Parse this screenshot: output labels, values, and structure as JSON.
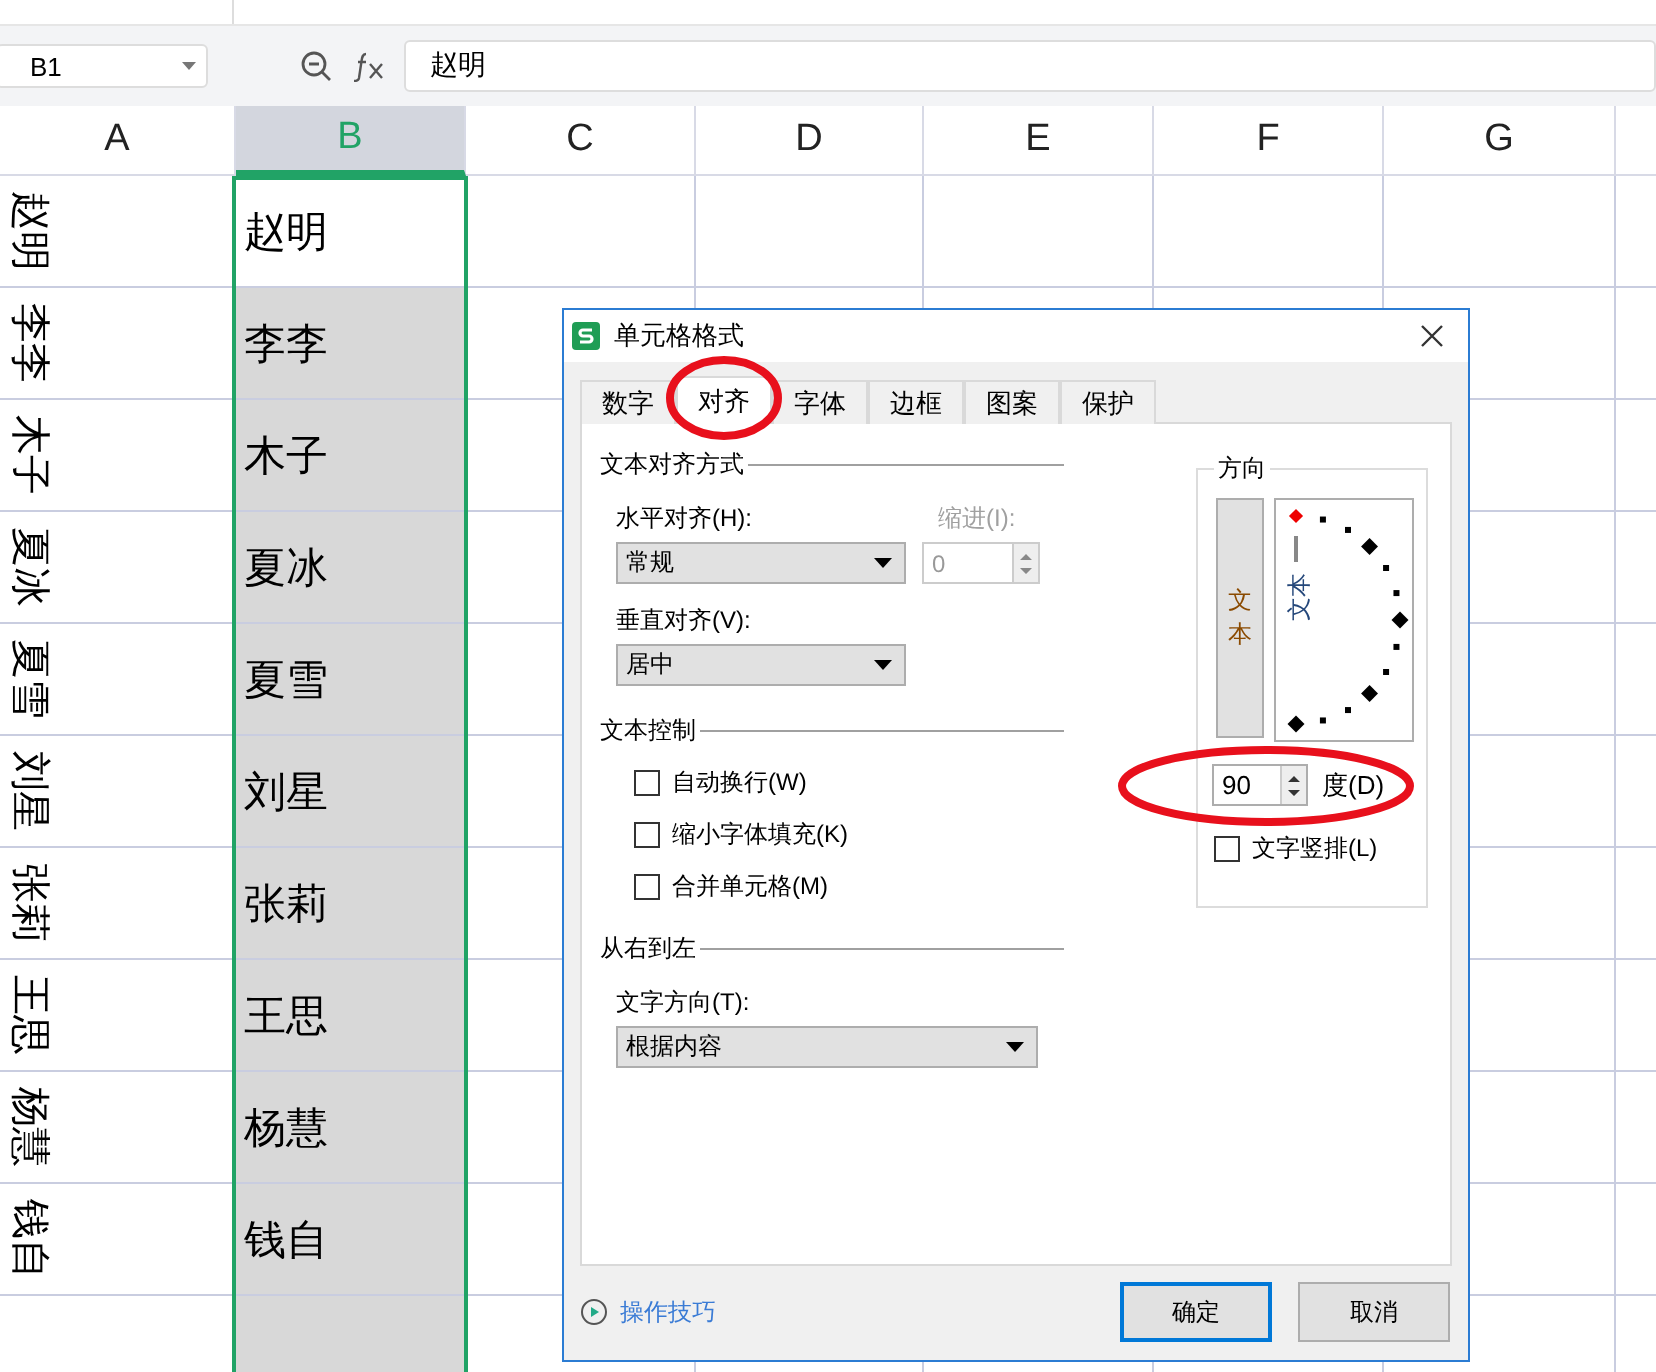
{
  "name_box": {
    "value": "B1"
  },
  "formula_bar": {
    "value": "赵明"
  },
  "columns": [
    {
      "label": "A",
      "selected": false
    },
    {
      "label": "B",
      "selected": true
    },
    {
      "label": "C",
      "selected": false
    },
    {
      "label": "D",
      "selected": false
    },
    {
      "label": "E",
      "selected": false
    },
    {
      "label": "F",
      "selected": false
    },
    {
      "label": "G",
      "selected": false
    }
  ],
  "rows": [
    {
      "a": "赵明",
      "b": "赵明",
      "b_active": true
    },
    {
      "a": "李李",
      "b": "李李",
      "b_active": false
    },
    {
      "a": "木子",
      "b": "木子",
      "b_active": false
    },
    {
      "a": "夏冰",
      "b": "夏冰",
      "b_active": false
    },
    {
      "a": "夏雪",
      "b": "夏雪",
      "b_active": false
    },
    {
      "a": "刘星",
      "b": "刘星",
      "b_active": false
    },
    {
      "a": "张莉",
      "b": "张莉",
      "b_active": false
    },
    {
      "a": "王思",
      "b": "王思",
      "b_active": false
    },
    {
      "a": "杨慧",
      "b": "杨慧",
      "b_active": false
    },
    {
      "a": "钱自",
      "b": "钱自",
      "b_active": false
    }
  ],
  "dialog": {
    "title": "单元格格式",
    "tabs": [
      {
        "label": "数字",
        "selected": false
      },
      {
        "label": "对齐",
        "selected": true
      },
      {
        "label": "字体",
        "selected": false
      },
      {
        "label": "边框",
        "selected": false
      },
      {
        "label": "图案",
        "selected": false
      },
      {
        "label": "保护",
        "selected": false
      }
    ],
    "alignment_section": "文本对齐方式",
    "horizontal_label": "水平对齐(H):",
    "horizontal_value": "常规",
    "indent_label": "缩进(I):",
    "indent_value": "0",
    "indent_disabled": true,
    "vertical_label": "垂直对齐(V):",
    "vertical_value": "居中",
    "text_control_section": "文本控制",
    "checkboxes": [
      {
        "label": "自动换行(W)",
        "checked": false
      },
      {
        "label": "缩小字体填充(K)",
        "checked": false
      },
      {
        "label": "合并单元格(M)",
        "checked": false
      }
    ],
    "rtl_section": "从右到左",
    "direction_label": "文字方向(T):",
    "direction_value": "根据内容",
    "orientation": {
      "title": "方向",
      "vertical_text": "文本",
      "dial_text": "文本",
      "degrees": "90",
      "degrees_label": "度(D)",
      "vertical_checkbox": {
        "label": "文字竖排(L)",
        "checked": false
      }
    },
    "tips_link": "操作技巧",
    "buttons": [
      {
        "label": "确定",
        "kind": "primary"
      },
      {
        "label": "取消",
        "kind": "normal"
      }
    ]
  }
}
